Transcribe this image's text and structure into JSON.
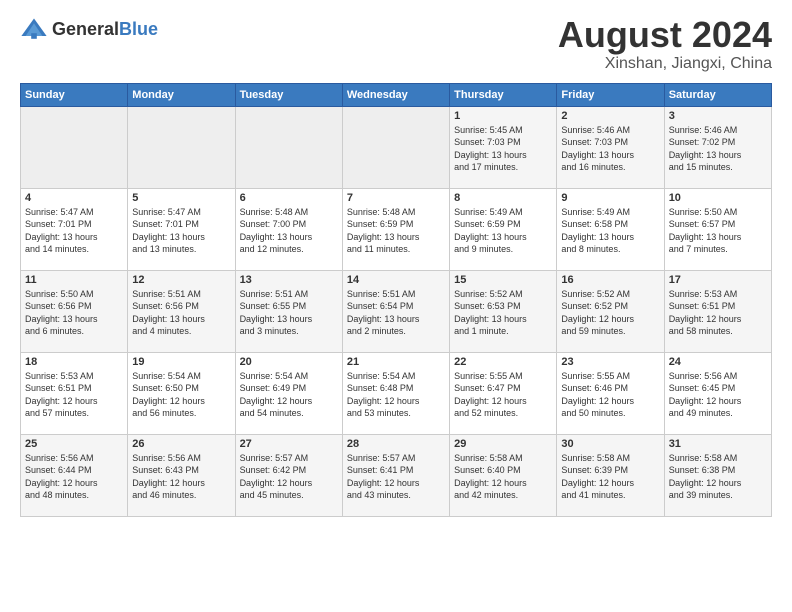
{
  "header": {
    "logo_general": "General",
    "logo_blue": "Blue",
    "month_title": "August 2024",
    "location": "Xinshan, Jiangxi, China"
  },
  "weekdays": [
    "Sunday",
    "Monday",
    "Tuesday",
    "Wednesday",
    "Thursday",
    "Friday",
    "Saturday"
  ],
  "weeks": [
    [
      {
        "day": "",
        "info": ""
      },
      {
        "day": "",
        "info": ""
      },
      {
        "day": "",
        "info": ""
      },
      {
        "day": "",
        "info": ""
      },
      {
        "day": "1",
        "info": "Sunrise: 5:45 AM\nSunset: 7:03 PM\nDaylight: 13 hours\nand 17 minutes."
      },
      {
        "day": "2",
        "info": "Sunrise: 5:46 AM\nSunset: 7:03 PM\nDaylight: 13 hours\nand 16 minutes."
      },
      {
        "day": "3",
        "info": "Sunrise: 5:46 AM\nSunset: 7:02 PM\nDaylight: 13 hours\nand 15 minutes."
      }
    ],
    [
      {
        "day": "4",
        "info": "Sunrise: 5:47 AM\nSunset: 7:01 PM\nDaylight: 13 hours\nand 14 minutes."
      },
      {
        "day": "5",
        "info": "Sunrise: 5:47 AM\nSunset: 7:01 PM\nDaylight: 13 hours\nand 13 minutes."
      },
      {
        "day": "6",
        "info": "Sunrise: 5:48 AM\nSunset: 7:00 PM\nDaylight: 13 hours\nand 12 minutes."
      },
      {
        "day": "7",
        "info": "Sunrise: 5:48 AM\nSunset: 6:59 PM\nDaylight: 13 hours\nand 11 minutes."
      },
      {
        "day": "8",
        "info": "Sunrise: 5:49 AM\nSunset: 6:59 PM\nDaylight: 13 hours\nand 9 minutes."
      },
      {
        "day": "9",
        "info": "Sunrise: 5:49 AM\nSunset: 6:58 PM\nDaylight: 13 hours\nand 8 minutes."
      },
      {
        "day": "10",
        "info": "Sunrise: 5:50 AM\nSunset: 6:57 PM\nDaylight: 13 hours\nand 7 minutes."
      }
    ],
    [
      {
        "day": "11",
        "info": "Sunrise: 5:50 AM\nSunset: 6:56 PM\nDaylight: 13 hours\nand 6 minutes."
      },
      {
        "day": "12",
        "info": "Sunrise: 5:51 AM\nSunset: 6:56 PM\nDaylight: 13 hours\nand 4 minutes."
      },
      {
        "day": "13",
        "info": "Sunrise: 5:51 AM\nSunset: 6:55 PM\nDaylight: 13 hours\nand 3 minutes."
      },
      {
        "day": "14",
        "info": "Sunrise: 5:51 AM\nSunset: 6:54 PM\nDaylight: 13 hours\nand 2 minutes."
      },
      {
        "day": "15",
        "info": "Sunrise: 5:52 AM\nSunset: 6:53 PM\nDaylight: 13 hours\nand 1 minute."
      },
      {
        "day": "16",
        "info": "Sunrise: 5:52 AM\nSunset: 6:52 PM\nDaylight: 12 hours\nand 59 minutes."
      },
      {
        "day": "17",
        "info": "Sunrise: 5:53 AM\nSunset: 6:51 PM\nDaylight: 12 hours\nand 58 minutes."
      }
    ],
    [
      {
        "day": "18",
        "info": "Sunrise: 5:53 AM\nSunset: 6:51 PM\nDaylight: 12 hours\nand 57 minutes."
      },
      {
        "day": "19",
        "info": "Sunrise: 5:54 AM\nSunset: 6:50 PM\nDaylight: 12 hours\nand 56 minutes."
      },
      {
        "day": "20",
        "info": "Sunrise: 5:54 AM\nSunset: 6:49 PM\nDaylight: 12 hours\nand 54 minutes."
      },
      {
        "day": "21",
        "info": "Sunrise: 5:54 AM\nSunset: 6:48 PM\nDaylight: 12 hours\nand 53 minutes."
      },
      {
        "day": "22",
        "info": "Sunrise: 5:55 AM\nSunset: 6:47 PM\nDaylight: 12 hours\nand 52 minutes."
      },
      {
        "day": "23",
        "info": "Sunrise: 5:55 AM\nSunset: 6:46 PM\nDaylight: 12 hours\nand 50 minutes."
      },
      {
        "day": "24",
        "info": "Sunrise: 5:56 AM\nSunset: 6:45 PM\nDaylight: 12 hours\nand 49 minutes."
      }
    ],
    [
      {
        "day": "25",
        "info": "Sunrise: 5:56 AM\nSunset: 6:44 PM\nDaylight: 12 hours\nand 48 minutes."
      },
      {
        "day": "26",
        "info": "Sunrise: 5:56 AM\nSunset: 6:43 PM\nDaylight: 12 hours\nand 46 minutes."
      },
      {
        "day": "27",
        "info": "Sunrise: 5:57 AM\nSunset: 6:42 PM\nDaylight: 12 hours\nand 45 minutes."
      },
      {
        "day": "28",
        "info": "Sunrise: 5:57 AM\nSunset: 6:41 PM\nDaylight: 12 hours\nand 43 minutes."
      },
      {
        "day": "29",
        "info": "Sunrise: 5:58 AM\nSunset: 6:40 PM\nDaylight: 12 hours\nand 42 minutes."
      },
      {
        "day": "30",
        "info": "Sunrise: 5:58 AM\nSunset: 6:39 PM\nDaylight: 12 hours\nand 41 minutes."
      },
      {
        "day": "31",
        "info": "Sunrise: 5:58 AM\nSunset: 6:38 PM\nDaylight: 12 hours\nand 39 minutes."
      }
    ]
  ]
}
